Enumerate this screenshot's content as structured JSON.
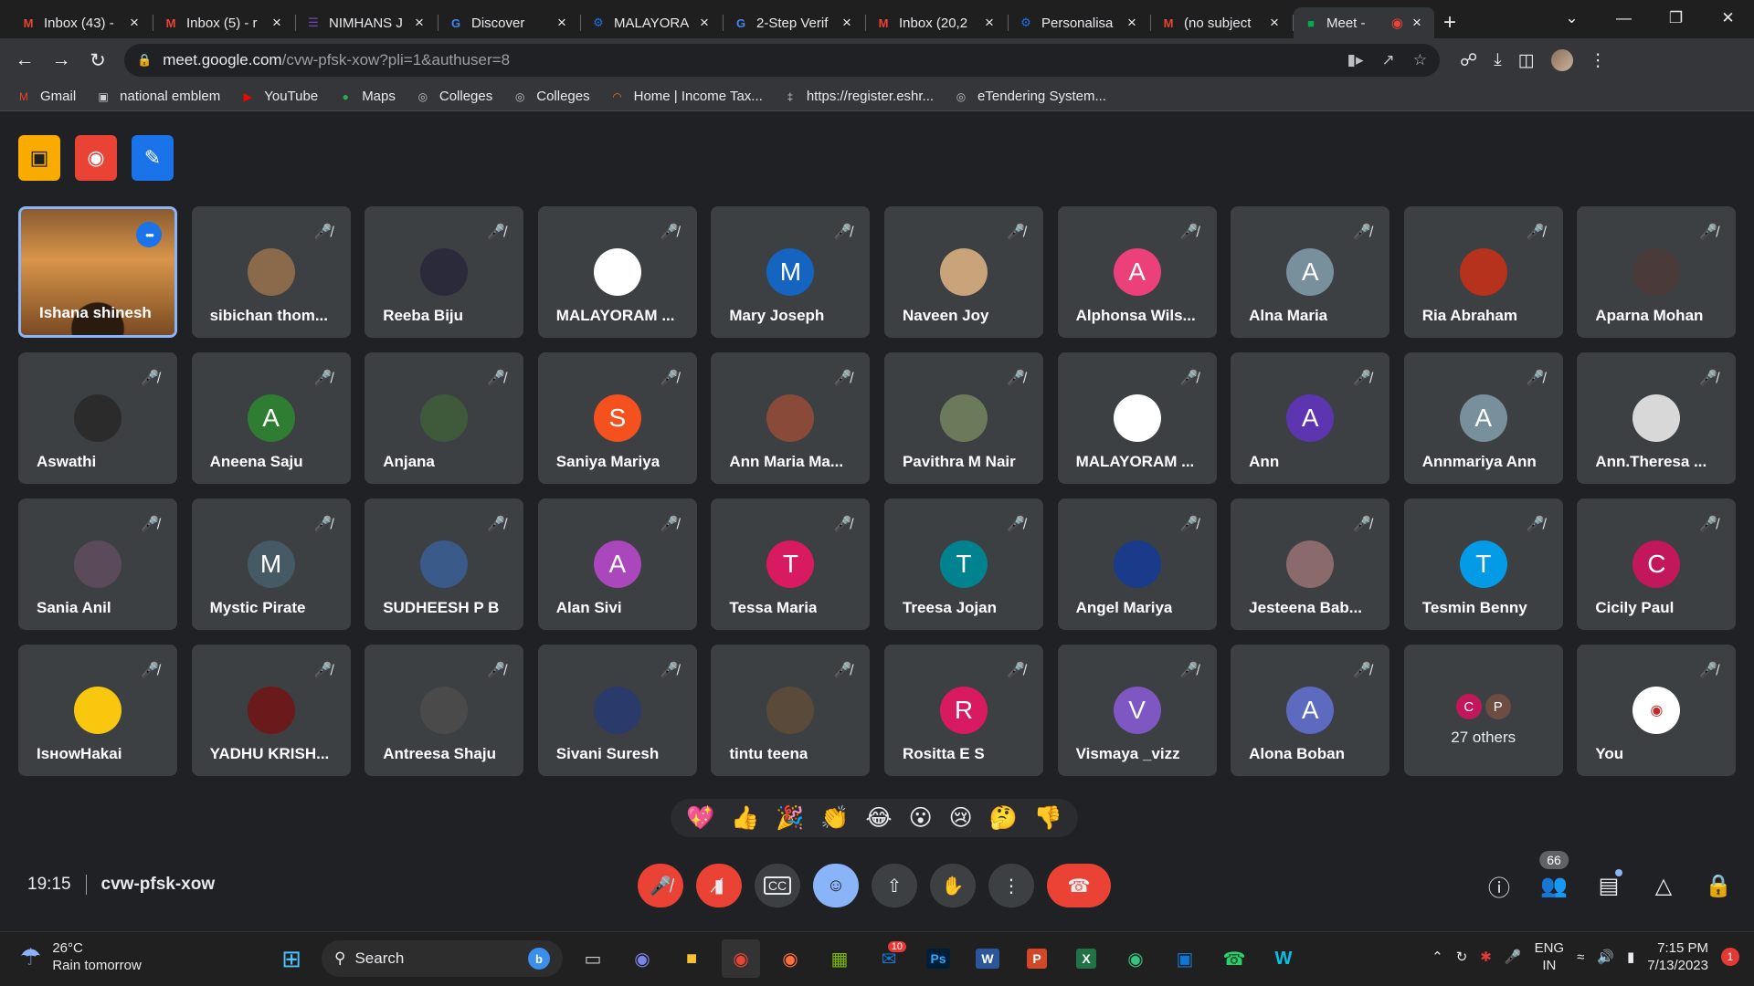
{
  "browser": {
    "tabs": [
      {
        "label": "Inbox (43) -",
        "icon": "gmail-icon",
        "color": "#ea4335",
        "glyph": "M",
        "active": false
      },
      {
        "label": "Inbox (5) - r",
        "icon": "gmail-icon",
        "color": "#ea4335",
        "glyph": "M",
        "active": false
      },
      {
        "label": "NIMHANS J",
        "icon": "forms-icon",
        "color": "#7248b9",
        "glyph": "☰",
        "active": false
      },
      {
        "label": "Discover",
        "icon": "google-icon",
        "color": "#4285f4",
        "glyph": "G",
        "active": false
      },
      {
        "label": "MALAYORA",
        "icon": "settings-cog-icon",
        "color": "#1a73e8",
        "glyph": "⚙",
        "active": false
      },
      {
        "label": "2-Step Verif",
        "icon": "google-icon",
        "color": "#4285f4",
        "glyph": "G",
        "active": false
      },
      {
        "label": "Inbox (20,2",
        "icon": "gmail-icon",
        "color": "#ea4335",
        "glyph": "M",
        "active": false
      },
      {
        "label": "Personalisa",
        "icon": "settings-cog-icon",
        "color": "#1a73e8",
        "glyph": "⚙",
        "active": false
      },
      {
        "label": "(no subject",
        "icon": "gmail-icon",
        "color": "#ea4335",
        "glyph": "M",
        "active": false
      },
      {
        "label": "Meet -",
        "icon": "meet-icon",
        "color": "#00ac47",
        "glyph": "■",
        "active": true
      }
    ],
    "url_host": "meet.google.com",
    "url_path": "/cvw-pfsk-xow?pli=1&authuser=8",
    "bookmarks": [
      {
        "label": "Gmail",
        "icon": "gmail-icon",
        "glyph": "M",
        "color": "#ea4335"
      },
      {
        "label": "national emblem",
        "icon": "emblem-icon",
        "glyph": "▣",
        "color": "#cfcfcf"
      },
      {
        "label": "YouTube",
        "icon": "youtube-icon",
        "glyph": "▶",
        "color": "#ff0000"
      },
      {
        "label": "Maps",
        "icon": "maps-icon",
        "glyph": "●",
        "color": "#34a853"
      },
      {
        "label": "Colleges",
        "icon": "globe-icon",
        "glyph": "◎",
        "color": "#bdc1c6"
      },
      {
        "label": "Colleges",
        "icon": "globe-icon",
        "glyph": "◎",
        "color": "#bdc1c6"
      },
      {
        "label": "Home | Income Tax...",
        "icon": "income-tax-icon",
        "glyph": "◠",
        "color": "#e8710a"
      },
      {
        "label": "https://register.eshr...",
        "icon": "register-icon",
        "glyph": "‡",
        "color": "#bdc1c6"
      },
      {
        "label": "eTendering System...",
        "icon": "globe-icon",
        "glyph": "◎",
        "color": "#bdc1c6"
      }
    ]
  },
  "meet": {
    "participants": [
      {
        "name": "Ishana shinesh",
        "speaking": true,
        "avatar_color": "#5a3a22",
        "initial": ""
      },
      {
        "name": "sibichan thom...",
        "avatar_color": "#8a6a4a",
        "initial": ""
      },
      {
        "name": "Reeba Biju",
        "avatar_color": "#2a2a3a",
        "initial": ""
      },
      {
        "name": "MALAYORAM ...",
        "avatar_color": "#ffffff",
        "initial": ""
      },
      {
        "name": "Mary Joseph",
        "avatar_color": "#1565c0",
        "initial": "M"
      },
      {
        "name": "Naveen Joy",
        "avatar_color": "#c9a37a",
        "initial": ""
      },
      {
        "name": "Alphonsa Wils...",
        "avatar_color": "#ec407a",
        "initial": "A"
      },
      {
        "name": "Alna Maria",
        "avatar_color": "#78909c",
        "initial": "A"
      },
      {
        "name": "Ria Abraham",
        "avatar_color": "#b7321c",
        "initial": ""
      },
      {
        "name": "Aparna Mohan",
        "avatar_color": "#4a3a3a",
        "initial": ""
      },
      {
        "name": "Aswathi",
        "avatar_color": "#2b2b2b",
        "initial": ""
      },
      {
        "name": "Aneena Saju",
        "avatar_color": "#2e7d32",
        "initial": "A"
      },
      {
        "name": "Anjana",
        "avatar_color": "#3e5a3a",
        "initial": ""
      },
      {
        "name": "Saniya Mariya",
        "avatar_color": "#f4511e",
        "initial": "S"
      },
      {
        "name": "Ann Maria Ma...",
        "avatar_color": "#8a4a3a",
        "initial": ""
      },
      {
        "name": "Pavithra M Nair",
        "avatar_color": "#6a7a5a",
        "initial": ""
      },
      {
        "name": "MALAYORAM ...",
        "avatar_color": "#ffffff",
        "initial": ""
      },
      {
        "name": "Ann",
        "avatar_color": "#5e35b1",
        "initial": "A"
      },
      {
        "name": "Annmariya Ann",
        "avatar_color": "#78909c",
        "initial": "A"
      },
      {
        "name": "Ann.Theresa ...",
        "avatar_color": "#d8d8d8",
        "initial": ""
      },
      {
        "name": "Sania Anil",
        "avatar_color": "#5a4a5a",
        "initial": ""
      },
      {
        "name": "Mystic Pirate",
        "avatar_color": "#455a64",
        "initial": "M"
      },
      {
        "name": "SUDHEESH P B",
        "avatar_color": "#3a5a8a",
        "initial": ""
      },
      {
        "name": "Alan Sivi",
        "avatar_color": "#ab47bc",
        "initial": "A"
      },
      {
        "name": "Tessa Maria",
        "avatar_color": "#d81b60",
        "initial": "T"
      },
      {
        "name": "Treesa Jojan",
        "avatar_color": "#00838f",
        "initial": "T"
      },
      {
        "name": "Angel Mariya",
        "avatar_color": "#1a3a8a",
        "initial": ""
      },
      {
        "name": "Jesteena Bab...",
        "avatar_color": "#8a6a6a",
        "initial": ""
      },
      {
        "name": "Tesmin Benny",
        "avatar_color": "#039be5",
        "initial": "T"
      },
      {
        "name": "Cicily Paul",
        "avatar_color": "#c2185b",
        "initial": "C"
      },
      {
        "name": "IsнowHakai",
        "avatar_color": "#f9c80e",
        "initial": ""
      },
      {
        "name": "YADHU KRISH...",
        "avatar_color": "#6a1a1a",
        "initial": ""
      },
      {
        "name": "Antreesa Shaju",
        "avatar_color": "#4a4a4a",
        "initial": ""
      },
      {
        "name": "Sivani Suresh",
        "avatar_color": "#2a3a6a",
        "initial": ""
      },
      {
        "name": "tintu teena",
        "avatar_color": "#5a4a3a",
        "initial": ""
      },
      {
        "name": "Rositta E S",
        "avatar_color": "#d81b60",
        "initial": "R"
      },
      {
        "name": "Vismaya _vizz",
        "avatar_color": "#7e57c2",
        "initial": "V"
      },
      {
        "name": "Alona Boban",
        "avatar_color": "#5c6bc0",
        "initial": "A"
      }
    ],
    "others": {
      "label": "27 others",
      "avatars": [
        {
          "initial": "C",
          "color": "#c2185b"
        },
        {
          "initial": "P",
          "color": "#6d4c41"
        }
      ]
    },
    "self_tile": {
      "name": "You",
      "avatar_color": "#ffffff"
    },
    "reactions": [
      "💖",
      "👍",
      "🎉",
      "👏",
      "😂",
      "😮",
      "😢",
      "🤔",
      "👎"
    ],
    "time": "19:15",
    "meeting_code": "cvw-pfsk-xow",
    "people_count": "66"
  },
  "taskbar": {
    "weather_temp": "26°C",
    "weather_desc": "Rain tomorrow",
    "search_placeholder": "Search",
    "mail_badge": "10",
    "lang_line1": "ENG",
    "lang_line2": "IN",
    "time": "7:15 PM",
    "date": "7/13/2023",
    "notif_count": "1"
  }
}
